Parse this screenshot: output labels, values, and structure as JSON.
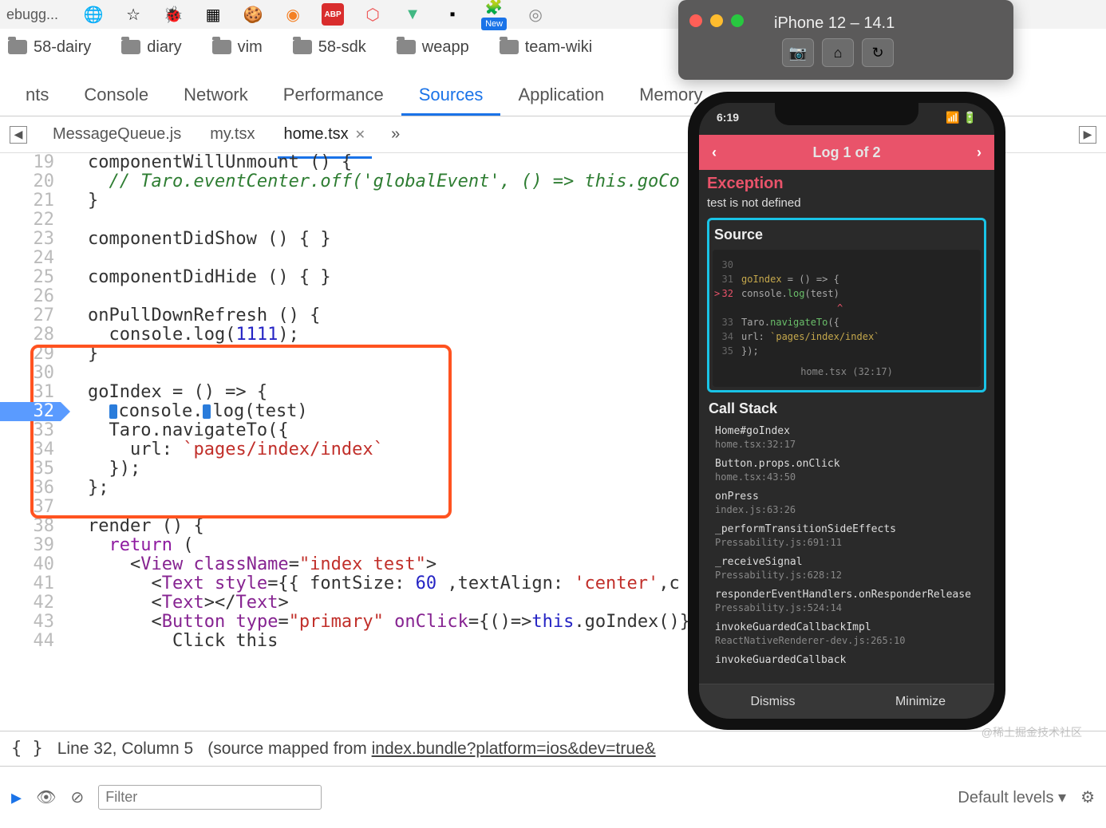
{
  "browser": {
    "tab_title": "ebugg..."
  },
  "bookmarks": [
    "58-dairy",
    "diary",
    "vim",
    "58-sdk",
    "weapp",
    "team-wiki"
  ],
  "devtools_tabs": [
    "nts",
    "Console",
    "Network",
    "Performance",
    "Sources",
    "Application",
    "Memory"
  ],
  "devtools_active": 4,
  "file_tabs": {
    "items": [
      "MessageQueue.js",
      "my.tsx",
      "home.tsx"
    ],
    "active": 2,
    "more": "»"
  },
  "code": {
    "start": 19,
    "breakpoint_line": 32,
    "hl_from": 29,
    "hl_to": 37
  },
  "status": {
    "cursor": "Line 32, Column 5",
    "mapped_prefix": "(source mapped from ",
    "mapped_link": "index.bundle?platform=ios&dev=true&"
  },
  "bottom": {
    "filter_placeholder": "Filter",
    "levels": "Default levels"
  },
  "simulator": {
    "title": "iPhone 12 – 14.1"
  },
  "phone": {
    "time": "6:19",
    "nav_title": "Log 1 of 2",
    "exception_title": "Exception",
    "exception_msg": "test is not defined",
    "source_title": "Source",
    "src_lines": [
      {
        "n": 30,
        "t": ""
      },
      {
        "n": 31,
        "t": "goIndex = () => {"
      },
      {
        "n": 32,
        "t": "    console.log(test)",
        "err": true
      },
      {
        "n": 33,
        "t": "    Taro.navigateTo({"
      },
      {
        "n": 34,
        "t": "      url: `pages/index/index`"
      },
      {
        "n": 35,
        "t": "    });"
      }
    ],
    "src_file": "home.tsx (32:17)",
    "callstack_title": "Call Stack",
    "stack": [
      {
        "fn": "Home#goIndex",
        "loc": "home.tsx:32:17"
      },
      {
        "fn": "Button.props.onClick",
        "loc": "home.tsx:43:50"
      },
      {
        "fn": "onPress",
        "loc": "index.js:63:26"
      },
      {
        "fn": "_performTransitionSideEffects",
        "loc": "Pressability.js:691:11"
      },
      {
        "fn": "_receiveSignal",
        "loc": "Pressability.js:628:12"
      },
      {
        "fn": "responderEventHandlers.onResponderRelease",
        "loc": "Pressability.js:524:14"
      },
      {
        "fn": "invokeGuardedCallbackImpl",
        "loc": "ReactNativeRenderer-dev.js:265:10"
      },
      {
        "fn": "invokeGuardedCallback",
        "loc": ""
      }
    ],
    "dismiss": "Dismiss",
    "minimize": "Minimize"
  },
  "watermark": "@稀土掘金技术社区"
}
